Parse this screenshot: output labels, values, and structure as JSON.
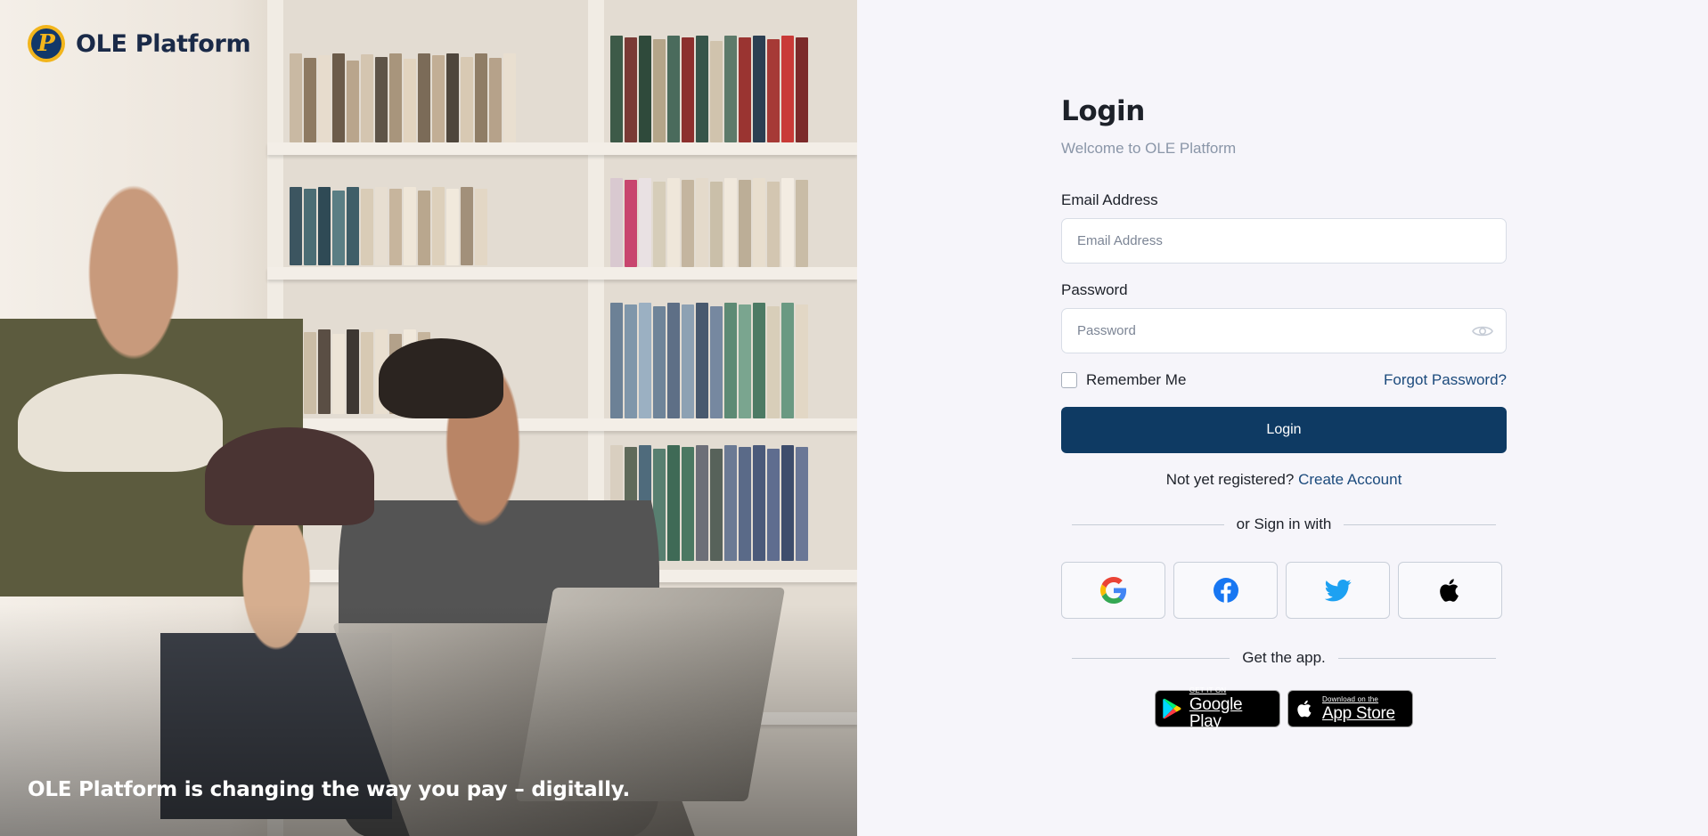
{
  "brand": {
    "name": "OLE Platform",
    "logo_letter": "P",
    "tagline": "OLE Platform is changing the way you pay – digitally."
  },
  "login": {
    "title": "Login",
    "subtitle": "Welcome to OLE Platform",
    "email_label": "Email Address",
    "email_placeholder": "Email Address",
    "email_value": "",
    "password_label": "Password",
    "password_placeholder": "Password",
    "password_value": "",
    "remember_label": "Remember Me",
    "remember_checked": false,
    "forgot_label": "Forgot Password?",
    "submit_label": "Login",
    "register_prompt": "Not yet registered?",
    "register_link": "Create Account",
    "social_divider": "or Sign in with",
    "social_providers": [
      "google-icon",
      "facebook-icon",
      "twitter-icon",
      "apple-icon"
    ],
    "app_divider": "Get the app."
  },
  "stores": {
    "google_small": "GET IT ON",
    "google_big": "Google Play",
    "apple_small": "Download on the",
    "apple_big": "App Store"
  },
  "colors": {
    "primary": "#0e3a63",
    "link": "#1b4a7c",
    "brand_yellow": "#f2b51c",
    "brand_navy": "#12386a",
    "panel_bg": "#f6f5fa"
  }
}
